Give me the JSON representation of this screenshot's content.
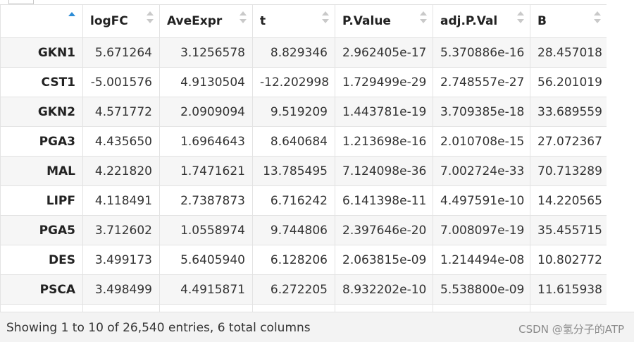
{
  "table": {
    "columns": [
      "",
      "logFC",
      "AveExpr",
      "t",
      "P.Value",
      "adj.P.Val",
      "B"
    ],
    "sorted_column": 0,
    "rows": [
      [
        "GKN1",
        "5.671264",
        "3.1256578",
        "8.829346",
        "2.962405e-17",
        "5.370886e-16",
        "28.457018"
      ],
      [
        "CST1",
        "-5.001576",
        "4.9130504",
        "-12.202998",
        "1.729499e-29",
        "2.748557e-27",
        "56.201019"
      ],
      [
        "GKN2",
        "4.571772",
        "2.0909094",
        "9.519209",
        "1.443781e-19",
        "3.709385e-18",
        "33.689559"
      ],
      [
        "PGA3",
        "4.435650",
        "1.6964643",
        "8.640684",
        "1.213698e-16",
        "2.010708e-15",
        "27.072367"
      ],
      [
        "MAL",
        "4.221820",
        "1.7471621",
        "13.785495",
        "7.124098e-36",
        "7.002724e-33",
        "70.713289"
      ],
      [
        "LIPF",
        "4.118491",
        "2.7387873",
        "6.716242",
        "6.141398e-11",
        "4.497591e-10",
        "14.220565"
      ],
      [
        "PGA5",
        "3.712602",
        "1.0558974",
        "9.744806",
        "2.397646e-20",
        "7.008097e-19",
        "35.455715"
      ],
      [
        "DES",
        "3.499173",
        "5.6405940",
        "6.128206",
        "2.063815e-09",
        "1.214494e-08",
        "10.802772"
      ],
      [
        "PSCA",
        "3.498499",
        "4.4915871",
        "6.272205",
        "8.932202e-10",
        "5.538800e-09",
        "11.615938"
      ],
      [
        "",
        "",
        "",
        "",
        "",
        "",
        ""
      ]
    ]
  },
  "footer": {
    "info": "Showing 1 to 10 of 26,540 entries, 6 total columns",
    "watermark": "CSDN @氢分子的ATP"
  },
  "colors": {
    "accent": "#2c8cd6",
    "stripe": "#f6f6f6",
    "footer_bg": "#f3f3f3"
  }
}
